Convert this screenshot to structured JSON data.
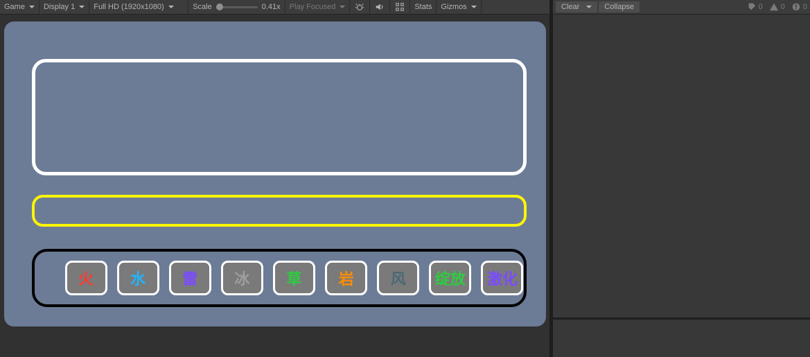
{
  "toolbar": {
    "game_dropdown": "Game",
    "display_dropdown": "Display 1",
    "resolution_dropdown": "Full HD (1920x1080)",
    "scale_label": "Scale",
    "scale_value": "0.41x",
    "play_mode": "Play Focused",
    "stats_label": "Stats",
    "gizmos_label": "Gizmos"
  },
  "console": {
    "clear_label": "Clear",
    "collapse_label": "Collapse",
    "info_count": "0",
    "warn_count": "0",
    "error_count": "0"
  },
  "elements": [
    {
      "label": "火",
      "color": "#FF3B30"
    },
    {
      "label": "水",
      "color": "#1FB6FF"
    },
    {
      "label": "雷",
      "color": "#7B4BFF"
    },
    {
      "label": "冰",
      "color": "#9E9E9E"
    },
    {
      "label": "草",
      "color": "#2ECC40"
    },
    {
      "label": "岩",
      "color": "#FF8C00"
    },
    {
      "label": "风",
      "color": "#4A6A75"
    },
    {
      "label": "绽放",
      "color": "#2ECC40"
    },
    {
      "label": "激化",
      "color": "#7B4BFF"
    }
  ]
}
